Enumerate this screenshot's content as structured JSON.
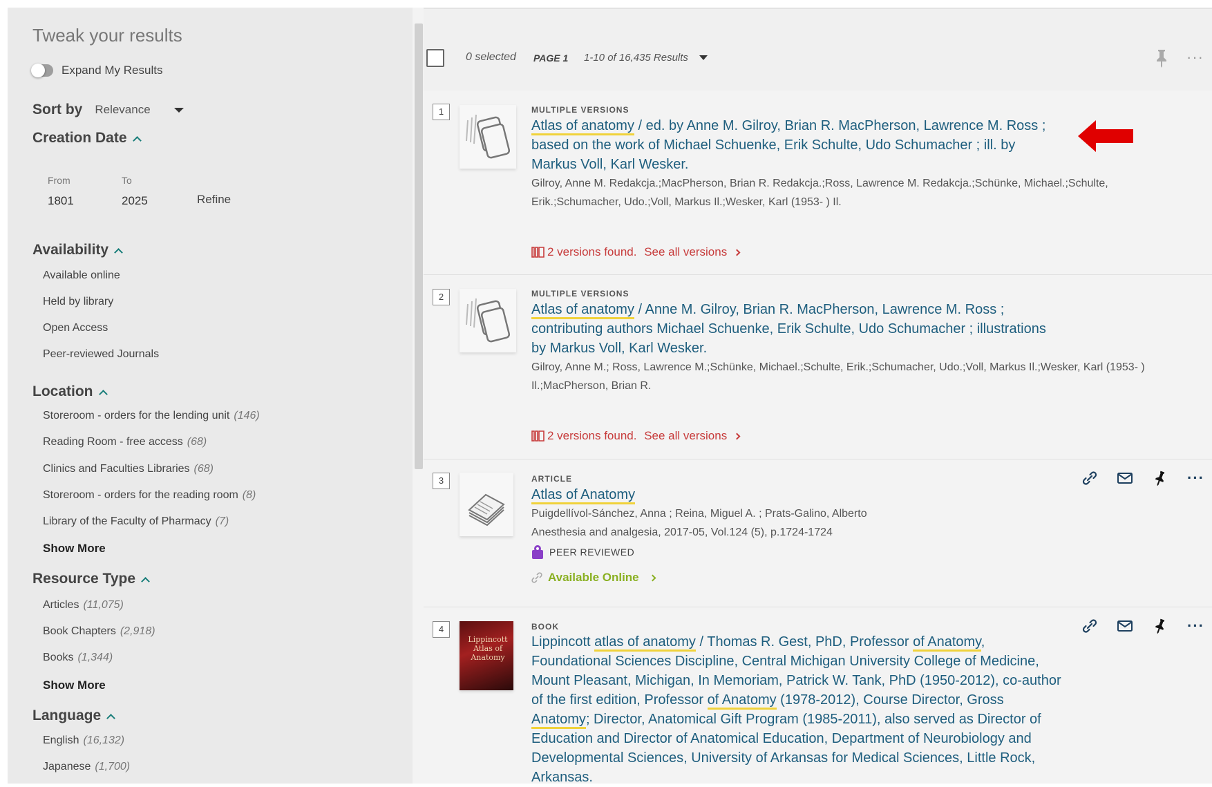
{
  "sidebar": {
    "title": "Tweak your results",
    "expand_label": "Expand My Results",
    "sort_label": "Sort by",
    "sort_value": "Relevance",
    "creation_date": {
      "heading": "Creation Date",
      "from_label": "From",
      "to_label": "To",
      "from_value": "1801",
      "to_value": "2025",
      "refine_label": "Refine"
    },
    "availability": {
      "heading": "Availability",
      "items": [
        "Available online",
        "Held by library",
        "Open Access",
        "Peer-reviewed Journals"
      ]
    },
    "location": {
      "heading": "Location",
      "items": [
        {
          "label": "Storeroom - orders for the lending unit",
          "count": "(146)"
        },
        {
          "label": "Reading Room - free access",
          "count": "(68)"
        },
        {
          "label": "Clinics and Faculties Libraries",
          "count": "(68)"
        },
        {
          "label": "Storeroom - orders for the reading room",
          "count": "(8)"
        },
        {
          "label": "Library of the Faculty of Pharmacy",
          "count": "(7)"
        }
      ],
      "show_more": "Show More"
    },
    "resource_type": {
      "heading": "Resource Type",
      "items": [
        {
          "label": "Articles",
          "count": "(11,075)"
        },
        {
          "label": "Book Chapters",
          "count": "(2,918)"
        },
        {
          "label": "Books",
          "count": "(1,344)"
        }
      ],
      "show_more": "Show More"
    },
    "language": {
      "heading": "Language",
      "items": [
        {
          "label": "English",
          "count": "(16,132)"
        },
        {
          "label": "Japanese",
          "count": "(1,700)"
        }
      ]
    }
  },
  "results_header": {
    "selected": "0 selected",
    "page": "PAGE 1",
    "count": "1-10 of 16,435 Results"
  },
  "results": [
    {
      "num": "1",
      "type": "MULTIPLE VERSIONS",
      "title_hl": "Atlas of anatomy",
      "title_rest": " / ed. by Anne M. Gilroy, Brian R. MacPherson, Lawrence M. Ross ; based on the work of Michael Schuenke, Erik Schulte, Udo Schumacher ; ill. by Markus Voll, Karl Wesker.",
      "authors": "Gilroy, Anne M. Redakcja.;MacPherson, Brian R. Redakcja.;Ross, Lawrence M. Redakcja.;Schünke, Michael.;Schulte, Erik.;Schumacher, Udo.;Voll, Markus Il.;Wesker, Karl (1953- ) Il.",
      "versions_found": "2 versions found.",
      "see_all": "See all versions"
    },
    {
      "num": "2",
      "type": "MULTIPLE VERSIONS",
      "title_hl": "Atlas of anatomy",
      "title_rest": " / Anne M. Gilroy, Brian R. MacPherson, Lawrence M. Ross ; contributing authors Michael Schuenke, Erik Schulte, Udo Schumacher ; illustrations by Markus Voll, Karl Wesker.",
      "authors": "Gilroy, Anne M.; Ross, Lawrence M.;Schünke, Michael.;Schulte, Erik.;Schumacher, Udo.;Voll, Markus Il.;Wesker, Karl (1953- ) Il.;MacPherson, Brian R.",
      "versions_found": "2 versions found.",
      "see_all": "See all versions"
    },
    {
      "num": "3",
      "type": "ARTICLE",
      "title_hl": "Atlas of Anatomy",
      "authors": "Puigdellívol-Sánchez, Anna ; Reina, Miguel A. ; Prats-Galino, Alberto",
      "source": "Anesthesia and analgesia, 2017-05, Vol.124 (5), p.1724-1724",
      "peer": "PEER REVIEWED",
      "availability": "Available Online"
    },
    {
      "num": "4",
      "type": "BOOK",
      "cover_title": "Lippincott Atlas of Anatomy",
      "title_p1": "Lippincott ",
      "title_hl1": "atlas of anatomy",
      "title_p2": " / Thomas R. Gest, PhD, Professor ",
      "title_hl2": "of Anatomy",
      "title_p3": ", Foundational Sciences Discipline, Central Michigan University College of Medicine, Mount Pleasant, Michigan, In Memoriam, Patrick W. Tank, PhD (1950-2012), co-author of the first edition, Professor ",
      "title_hl3": "of Anatomy",
      "title_p4": " (1978-2012), Course Director, Gross ",
      "title_hl4": "Anatomy",
      "title_p5": "; Director, Anatomical Gift Program (1985-2011), also served as Director of Education and Director of Anatomical Education, Department of Neurobiology and Developmental Sciences, University of Arkansas for Medical Sciences, Little Rock, Arkansas."
    }
  ],
  "colors": {
    "link": "#1e5e7e",
    "highlight": "#f0d23a",
    "versions": "#c73b3b",
    "available": "#8ab022",
    "annotation_arrow": "#e00000"
  }
}
